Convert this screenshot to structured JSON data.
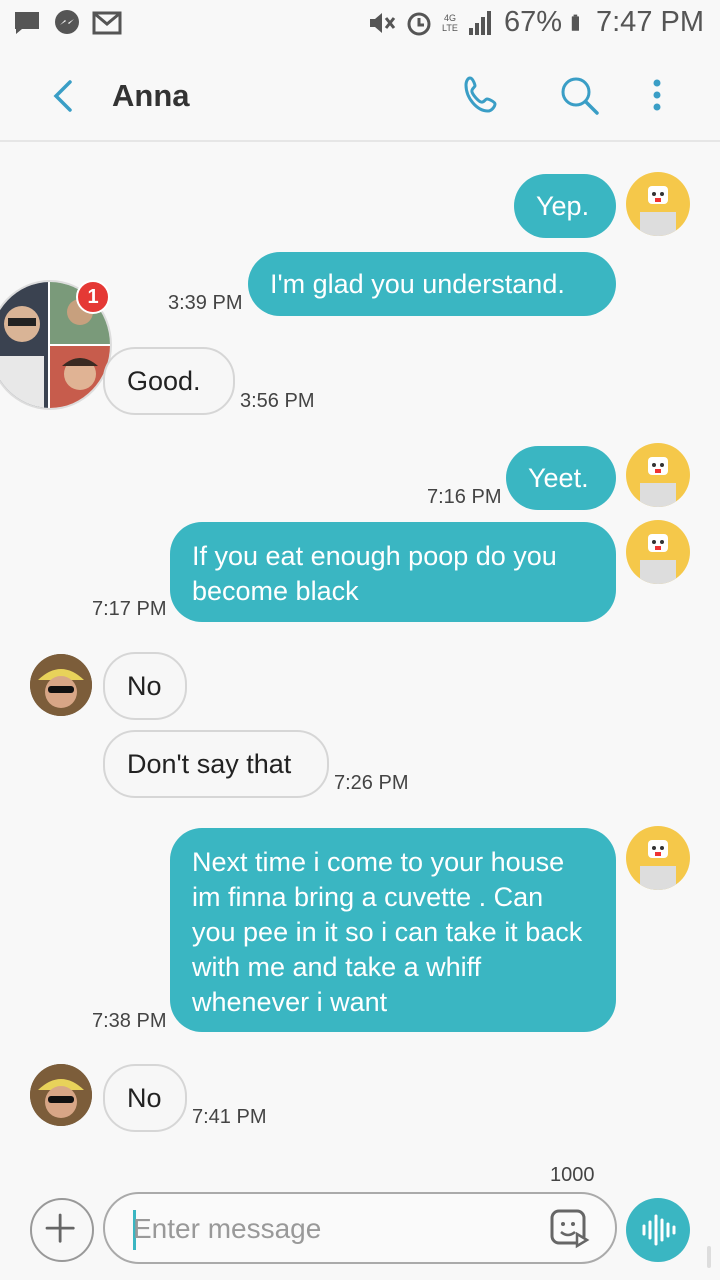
{
  "status_bar": {
    "battery": "67%",
    "time": "7:47 PM",
    "network": "4G LTE"
  },
  "header": {
    "contact_name": "Anna"
  },
  "messages": [
    {
      "dir": "out",
      "text": "Yep.",
      "time": ""
    },
    {
      "dir": "out",
      "text": "I'm glad you understand.",
      "time": "3:39 PM"
    },
    {
      "dir": "in",
      "text": "Good.",
      "time": "3:56 PM"
    },
    {
      "dir": "out",
      "text": "Yeet.",
      "time": "7:16 PM"
    },
    {
      "dir": "out",
      "text": "If you eat enough poop do you become black",
      "time": "7:17 PM"
    },
    {
      "dir": "in",
      "text": "No",
      "time": ""
    },
    {
      "dir": "in",
      "text": "Don't say that",
      "time": "7:26 PM"
    },
    {
      "dir": "out",
      "text": "Next time i come to your house im finna bring a cuvette . Can you pee in it so i can take it back with me and take a whiff whenever i want",
      "time": "7:38 PM"
    },
    {
      "dir": "in",
      "text": "No",
      "time": "7:41 PM"
    }
  ],
  "group_badge": "1",
  "composer": {
    "char_count": "1000",
    "placeholder": "Enter message"
  },
  "colors": {
    "accent": "#3ab6c2",
    "badge": "#e53935",
    "incoming_bg": "#f7f7f7"
  },
  "icons": [
    "messages-icon",
    "messenger-icon",
    "gmail-icon",
    "mute-icon",
    "alarm-icon",
    "signal-icon",
    "battery-icon",
    "back-icon",
    "phone-icon",
    "search-icon",
    "more-icon",
    "plus-icon",
    "sticker-icon",
    "voice-icon"
  ]
}
